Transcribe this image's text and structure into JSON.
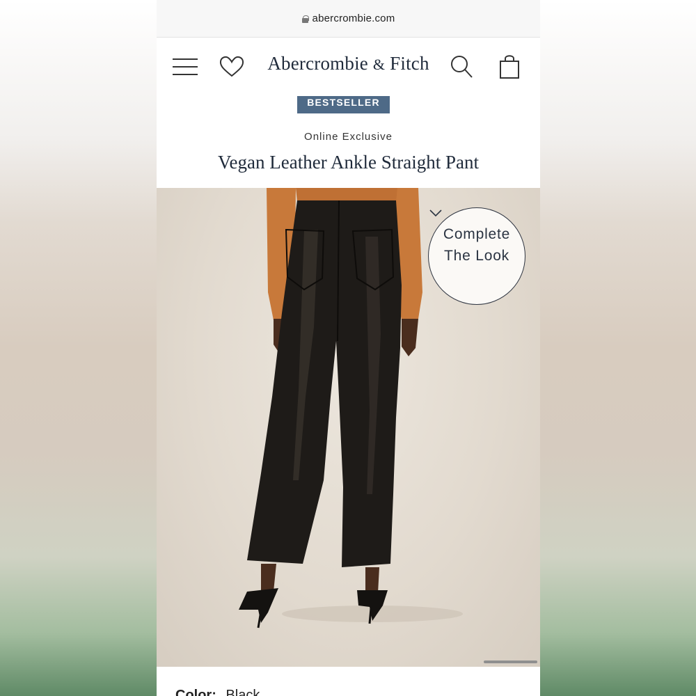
{
  "browser": {
    "url": "abercrombie.com"
  },
  "header": {
    "brand_main": "Abercrombie",
    "brand_amp": "&",
    "brand_end": "Fitch"
  },
  "product": {
    "badge": "BESTSELLER",
    "tagline": "Online Exclusive",
    "title": "Vegan Leather Ankle Straight Pant",
    "complete_look_line1": "Complete",
    "complete_look_line2": "The Look",
    "color_label": "Color:",
    "color_value": "Black"
  },
  "colors": {
    "badge_bg": "#4e6a87",
    "brand_text": "#1f2a3a",
    "pants": "#1e1b18",
    "sweater": "#c8793a"
  },
  "icons": [
    "menu-icon",
    "heart-icon",
    "search-icon",
    "shopping-bag-icon",
    "lock-icon",
    "chevron-down-icon"
  ]
}
